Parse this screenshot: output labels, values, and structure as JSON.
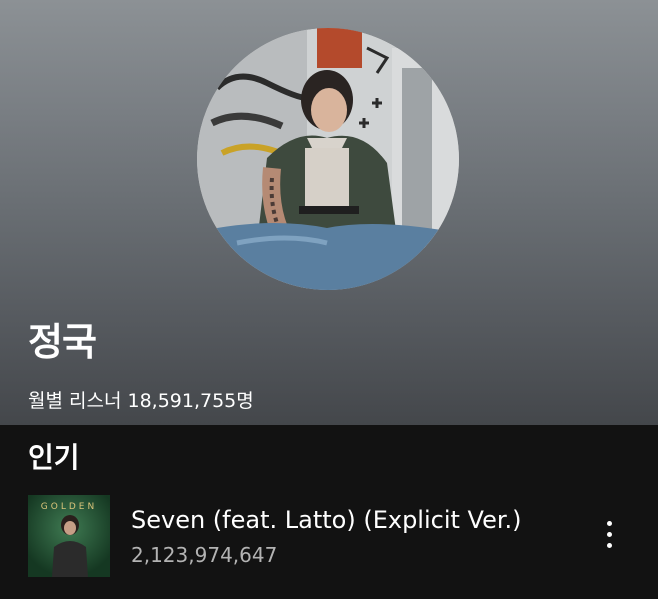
{
  "artist": {
    "name": "정국",
    "monthly_listeners": "월별 리스너 18,591,755명"
  },
  "popular": {
    "title": "인기",
    "tracks": [
      {
        "title": "Seven (feat. Latto) (Explicit Ver.)",
        "plays": "2,123,974,647",
        "album_art_text": "GOLDEN"
      }
    ]
  },
  "icons": {
    "more": "more-vertical-icon"
  },
  "colors": {
    "background": "#121212",
    "secondary_text": "#b3b3b3",
    "hero_gradient_top": "#8c9195",
    "hero_gradient_bottom": "#44474b"
  }
}
